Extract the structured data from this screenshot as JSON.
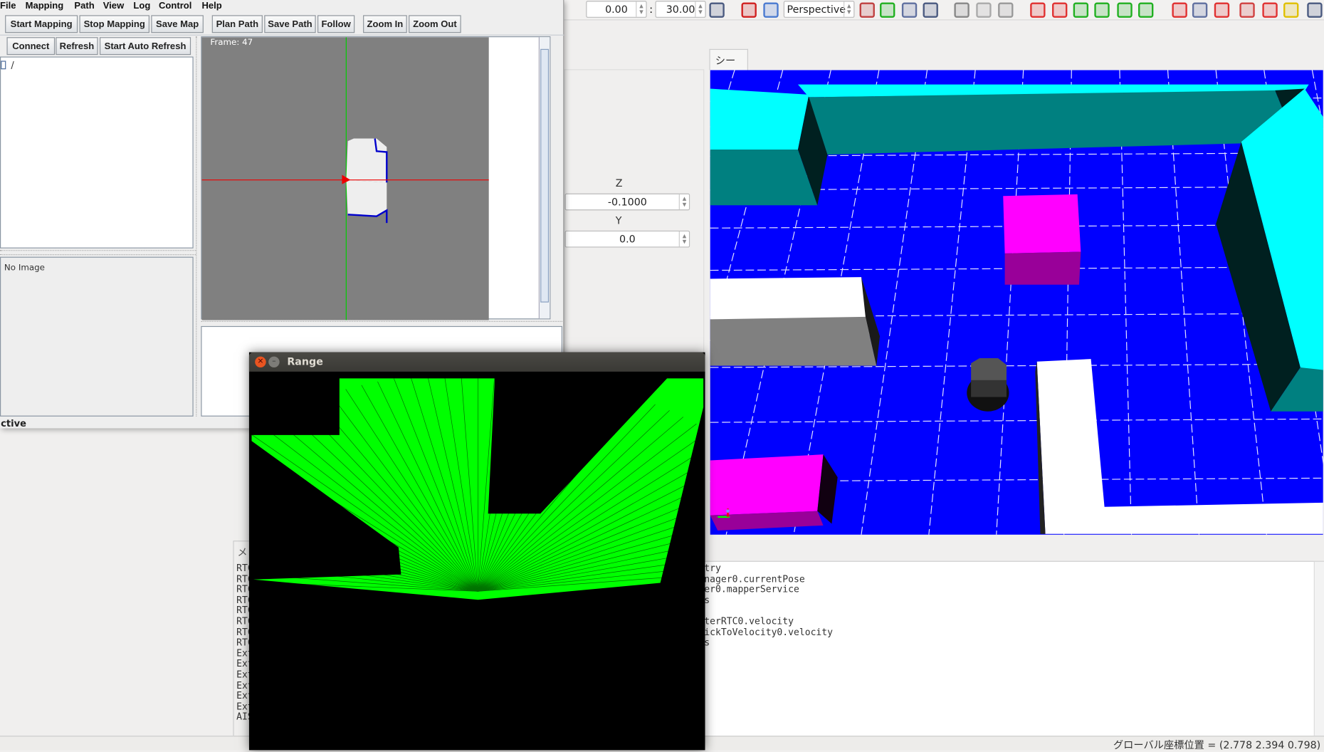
{
  "choreonoid": {
    "toolbar": {
      "time_start": "0.00",
      "time_end": "30.00",
      "time_separator": ":",
      "camera_mode": "Perspective",
      "icons": [
        {
          "name": "wrench-icon",
          "color": "#4a5a80"
        },
        {
          "name": "edit-mode-icon",
          "color": "#d02020"
        },
        {
          "name": "view-rotate-icon",
          "color": "#4a7ad0"
        },
        {
          "name": "camera-select-icon",
          "color": "#c04040"
        },
        {
          "name": "light-burst-icon",
          "color": "#20b020"
        },
        {
          "name": "grid-icon",
          "color": "#6070a0"
        },
        {
          "name": "wrench-icon",
          "color": "#4a5a80"
        },
        {
          "name": "graph-wave-icon",
          "color": "#888888"
        },
        {
          "name": "graph-edit-icon",
          "color": "#aaaaaa"
        },
        {
          "name": "wrench-icon",
          "color": "#999999"
        },
        {
          "name": "sim-start-icon",
          "color": "#e03030"
        },
        {
          "name": "sim-restart-icon",
          "color": "#e03030"
        },
        {
          "name": "sim-step-icon",
          "color": "#20b020"
        },
        {
          "name": "play-icon",
          "color": "#20b020"
        },
        {
          "name": "pause-icon",
          "color": "#20b020"
        },
        {
          "name": "stop-icon",
          "color": "#20b020"
        },
        {
          "name": "body-tracking-icon",
          "color": "#e03030"
        },
        {
          "name": "collision-icon",
          "color": "#6070a0"
        },
        {
          "name": "ik-icon",
          "color": "#e03030"
        },
        {
          "name": "globe-icon",
          "color": "#d04040"
        },
        {
          "name": "compress-icon",
          "color": "#e03030"
        },
        {
          "name": "windows-icon",
          "color": "#e0c000"
        },
        {
          "name": "wrench-icon",
          "color": "#4a5a80"
        }
      ]
    },
    "properties": {
      "z_label": "Z",
      "z_value": "-0.1000",
      "y_label": "Y",
      "y_value": "0.0"
    },
    "scene_tab": "シーン",
    "message_tab": "メ",
    "message_lines": [
      "RTC",
      "RTC",
      "RTC",
      "RTC",
      "RTC",
      "RTC",
      "RTC",
      "RTC",
      "Ext",
      "Ext",
      "Ext",
      "Ext",
      "Ext",
      "Ext",
      "AIS"
    ],
    "log_lines": [
      "try",
      "nager0.currentPose",
      "er0.mapperService",
      "s",
      "",
      "terRTC0.velocity",
      "ickToVelocity0.velocity",
      "s"
    ],
    "status": "グローバル座標位置 = (2.778 2.394 0.798)"
  },
  "mapper_window": {
    "menu": [
      "File",
      "Mapping",
      "Path",
      "View",
      "Log",
      "Control",
      "Help"
    ],
    "toolbar": {
      "start_mapping": "Start Mapping",
      "stop_mapping": "Stop Mapping",
      "save_map": "Save Map",
      "plan_path": "Plan Path",
      "save_path": "Save Path",
      "follow": "Follow",
      "zoom_in": "Zoom In",
      "zoom_out": "Zoom Out"
    },
    "rtc_buttons": {
      "connect": "Connect",
      "refresh": "Refresh",
      "auto_refresh": "Start Auto Refresh"
    },
    "tree_root": "/",
    "image_label": "No Image",
    "frame_label": "Frame: 47",
    "status": "ctive"
  },
  "range_window": {
    "title": "Range"
  }
}
